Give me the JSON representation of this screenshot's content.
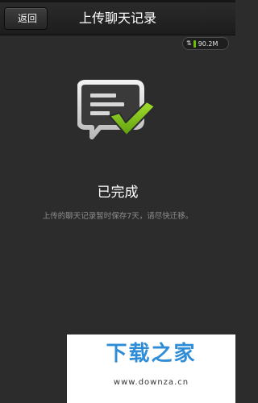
{
  "header": {
    "back_label": "返回",
    "title": "上传聊天记录"
  },
  "traffic_badge": {
    "direction_icon": "up-down-arrows-icon",
    "value": "90.2M",
    "accent": "#6cc000"
  },
  "main": {
    "icon": "chat-document-checkmark-icon",
    "status_title": "已完成",
    "status_note": "上传的聊天记录暂时保存7天，请尽快迁移。"
  },
  "watermark": {
    "logo_text": "下载之家",
    "url": "www.downza.cn"
  },
  "colors": {
    "background": "#2c2c2c",
    "check_green": "#7ec11a",
    "watermark_blue": "#2f8dd7"
  }
}
